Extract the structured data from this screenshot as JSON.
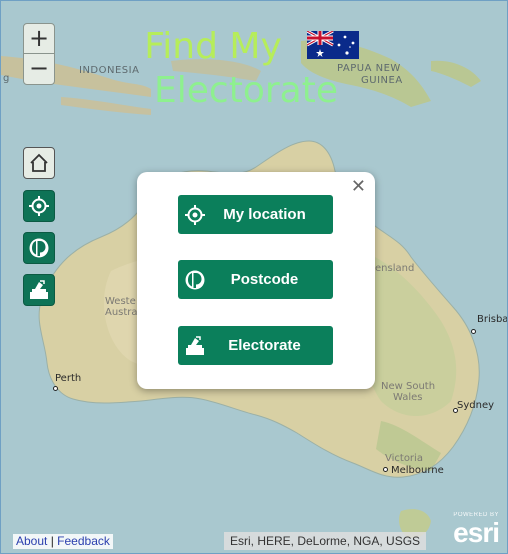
{
  "title": {
    "line1": "Find My",
    "line2": "Electorate"
  },
  "flag": {
    "icon": "australian-flag-icon"
  },
  "zoom": {
    "in_label": "+",
    "out_label": "−"
  },
  "side_buttons": [
    {
      "icon": "home-icon"
    },
    {
      "icon": "crosshair-location-icon"
    },
    {
      "icon": "postcode-icon"
    },
    {
      "icon": "ballot-box-icon"
    }
  ],
  "modal": {
    "close_label": "✕",
    "buttons": [
      {
        "label": "My location",
        "icon": "crosshair-location-icon"
      },
      {
        "label": "Postcode",
        "icon": "postcode-icon"
      },
      {
        "label": "Electorate",
        "icon": "ballot-box-icon"
      }
    ]
  },
  "map": {
    "labels": {
      "indonesia": "INDONESIA",
      "papua": "PAPUA NEW",
      "guinea": "GUINEA",
      "west_1": "Weste",
      "west_2": "Austra",
      "queensland": "ensland",
      "nsw_1": "New South",
      "nsw_2": "Wales",
      "victoria": "Victoria",
      "left_g": "g"
    },
    "cities": {
      "perth": "Perth",
      "sydney": "Sydney",
      "melbourne": "Melbourne",
      "brisbane": "Brisba"
    }
  },
  "footer": {
    "about": "About",
    "sep": "|",
    "feedback": "Feedback"
  },
  "attribution": "Esri, HERE, DeLorme, NGA, USGS",
  "esri": {
    "powered": "POWERED BY",
    "name": "esri"
  },
  "colors": {
    "accent_green": "#0b7f5b",
    "title_green": "#b6ed5a",
    "title_green2": "#8ef08f"
  }
}
